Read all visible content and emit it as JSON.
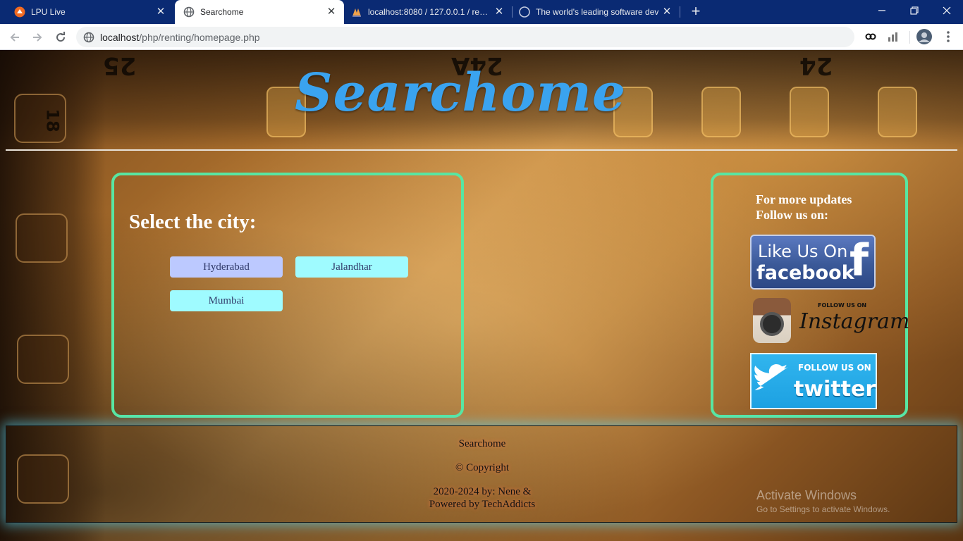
{
  "browser": {
    "tabs": [
      {
        "title": "LPU Live",
        "icon": "lpu-live-icon"
      },
      {
        "title": "Searchome",
        "icon": "globe-icon"
      },
      {
        "title": "localhost:8080 / 127.0.0.1 / renting",
        "icon": "phpmyadmin-icon"
      },
      {
        "title": "The world's leading software dev",
        "icon": "github-icon"
      }
    ],
    "new_tab_label": "+",
    "url_host": "localhost",
    "url_path": "/php/renting/homepage.php"
  },
  "page": {
    "brand_title": "Searchome",
    "city_heading": "Select the city:",
    "cities": [
      "Hyderabad",
      "Jalandhar",
      "Mumbai"
    ],
    "colors": {
      "brand": "#3aa3ef",
      "box_border": "#58e6a2",
      "city_button_selected": "#bcc9ff",
      "city_button": "#9ffbff"
    },
    "social": {
      "line1": "For more updates",
      "line2": "Follow us on:",
      "facebook_line1": "Like Us On",
      "facebook_line2": "facebook",
      "facebook_f": "f",
      "instagram_follow": "FOLLOW US ON",
      "instagram_name": "Instagram",
      "twitter_follow": "FOLLOW US ON",
      "twitter_name": "twitter"
    },
    "footer": {
      "brand": "Searchome",
      "copyright": "© Copyright",
      "credit_line1": "2020-2024 by: Nene &",
      "credit_line2": "Powered by TechAddicts"
    },
    "film_numbers": [
      "25",
      "24A",
      "24",
      "18"
    ],
    "watermark_line1": "Activate Windows",
    "watermark_line2": "Go to Settings to activate Windows."
  }
}
